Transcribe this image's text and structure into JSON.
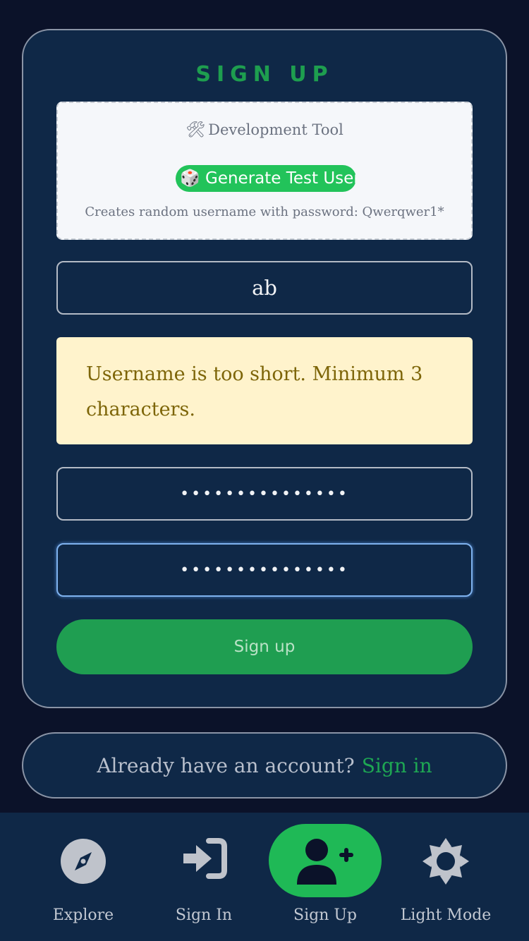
{
  "page_title": "SIGN UP",
  "dev_tool": {
    "heading": "Development Tool",
    "heading_icon": "tools-icon",
    "generate_button_label": "Generate Test User",
    "generate_button_icon": "dice-icon",
    "note": "Creates random username with password: Qwerqwer1*"
  },
  "form": {
    "username_value": "ab",
    "warning": "Username is too short. Minimum 3 characters.",
    "password_mask": "•••••••••••••••",
    "confirm_password_mask": "•••••••••••••••",
    "submit_label": "Sign up"
  },
  "signin_prompt": {
    "text": "Already have an account?",
    "link": "Sign in"
  },
  "bottom_nav": {
    "active": "Sign Up",
    "items": [
      {
        "label": "Explore",
        "icon": "compass-icon"
      },
      {
        "label": "Sign In",
        "icon": "sign-in-icon"
      },
      {
        "label": "Sign Up",
        "icon": "user-plus-icon"
      },
      {
        "label": "Light Mode",
        "icon": "sun-gear-icon"
      }
    ]
  },
  "colors": {
    "background": "#0b1229",
    "card": "#0f2847",
    "accent_green": "#1e9e4f",
    "active_pill": "#1fb956",
    "warning_bg": "#fff3cc",
    "warning_text": "#7d6508"
  }
}
